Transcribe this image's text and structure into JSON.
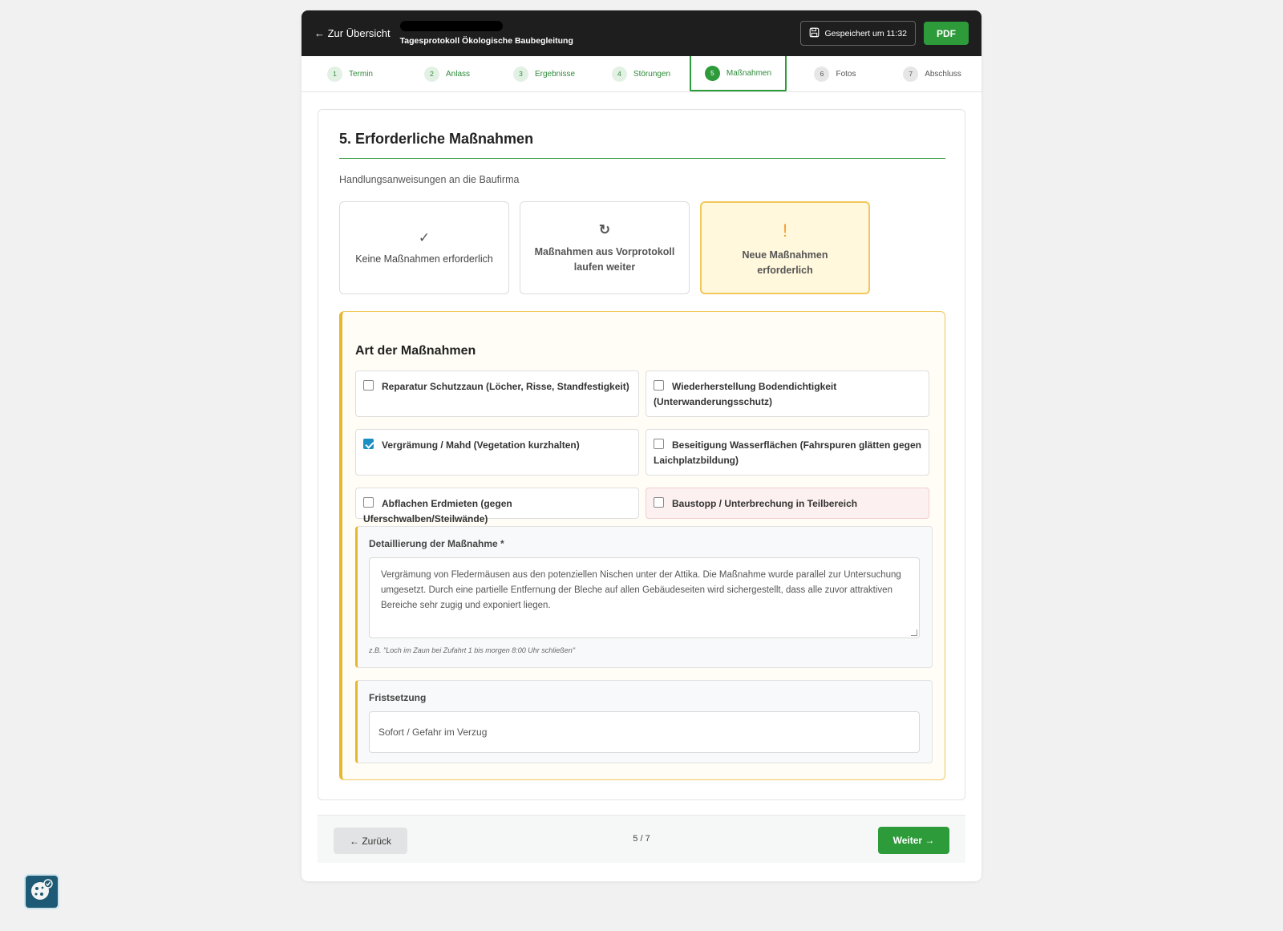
{
  "header": {
    "back_label": "← Zur Übersicht",
    "doc_title": "Tagesprotokoll Ökologische Baubegleitung",
    "saved_label": "Gespeichert um 11:32",
    "pdf_label": "PDF"
  },
  "steps": [
    {
      "num": "1",
      "label": "Termin"
    },
    {
      "num": "2",
      "label": "Anlass"
    },
    {
      "num": "3",
      "label": "Ergebnisse"
    },
    {
      "num": "4",
      "label": "Störungen"
    },
    {
      "num": "5",
      "label": "Maßnahmen"
    },
    {
      "num": "6",
      "label": "Fotos"
    },
    {
      "num": "7",
      "label": "Abschluss"
    }
  ],
  "section": {
    "title": "5. Erforderliche Maßnahmen",
    "subtitle": "Handlungsanweisungen an die Baufirma"
  },
  "choices": [
    {
      "icon": "✓",
      "label": "Keine Maßnahmen erforderlich"
    },
    {
      "icon": "↻",
      "label": "Maßnahmen aus Vorprotokoll laufen weiter"
    },
    {
      "icon": "!",
      "label": "Neue Maßnahmen erforderlich"
    }
  ],
  "measures": {
    "title": "Art der Maßnahmen",
    "options": [
      {
        "label": "Reparatur Schutzzaun (Löcher, Risse, Standfestigkeit)",
        "checked": false
      },
      {
        "label": "Wiederherstellung Bodendichtigkeit (Unterwanderungsschutz)",
        "checked": false
      },
      {
        "label": "Vergrämung / Mahd (Vegetation kurzhalten)",
        "checked": true
      },
      {
        "label": "Beseitigung Wasserflächen (Fahrspuren glätten gegen Laichplatzbildung)",
        "checked": false
      },
      {
        "label": "Abflachen Erdmieten (gegen Uferschwalben/Steilwände)",
        "checked": false
      },
      {
        "label": "Baustopp / Unterbrechung in Teilbereich",
        "checked": false
      }
    ],
    "detail_label": "Detaillierung der Maßnahme *",
    "detail_value": "Vergrämung von Fledermäusen aus den potenziellen Nischen unter der Attika. Die Maßnahme wurde parallel zur Untersuchung umgesetzt. Durch eine partielle Entfernung der Bleche auf allen Gebäudeseiten wird sichergestellt, dass alle zuvor attraktiven Bereiche sehr zugig und exponiert liegen.",
    "detail_hint": "z.B. \"Loch im Zaun bei Zufahrt 1 bis morgen 8:00 Uhr schließen\"",
    "deadline_label": "Fristsetzung",
    "deadline_value": "Sofort / Gefahr im Verzug"
  },
  "footer": {
    "back_label": "← Zurück",
    "progress": "5 / 7",
    "next_label": "Weiter →"
  },
  "colors": {
    "accent_green": "#2e9b3a",
    "warning_yellow": "#e7b72e",
    "checkbox_blue": "#1a8fc2",
    "topbar": "#1e1e1e"
  }
}
